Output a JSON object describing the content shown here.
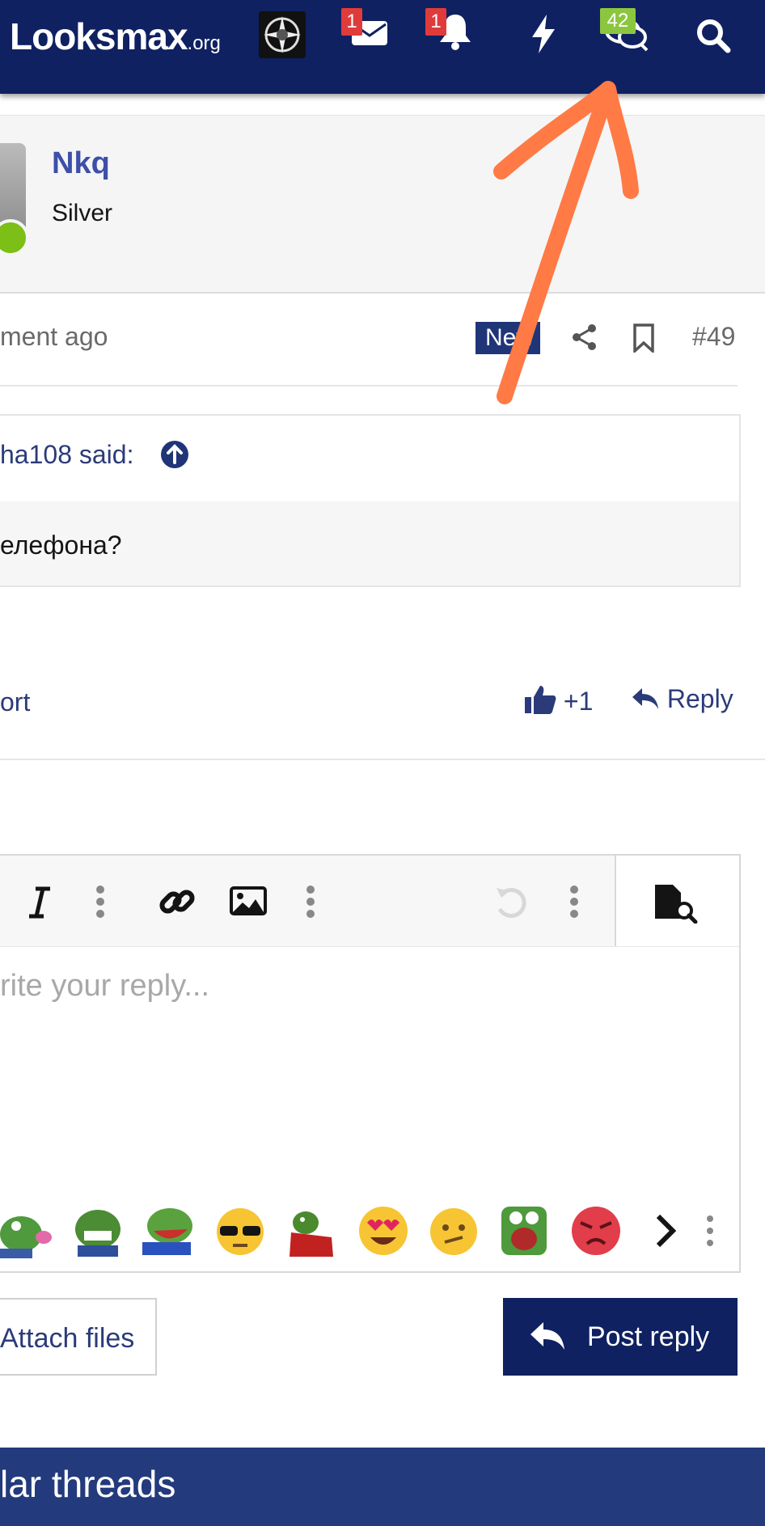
{
  "header": {
    "logo_main": "Looksmax",
    "logo_suffix": ".org",
    "messages_badge": "1",
    "alerts_badge": "1",
    "chats_badge": "42",
    "colors": {
      "bg": "#0f2161",
      "badge_red": "#e03b3b",
      "badge_green": "#8cc63f"
    }
  },
  "user": {
    "name": "Nkq",
    "title": "Silver",
    "online": true
  },
  "post_meta": {
    "time": "ment ago",
    "new_label": "New",
    "post_number": "#49"
  },
  "quote": {
    "author": "ha108 said:",
    "text": "елефона?"
  },
  "actions": {
    "report": "ort",
    "like": "+1",
    "reply": "Reply"
  },
  "editor": {
    "placeholder": "rite your reply...",
    "toolbar_icons": [
      "italic-icon",
      "more-icon",
      "link-icon",
      "image-icon",
      "more-icon",
      "undo-icon",
      "more-icon",
      "preview-icon"
    ],
    "emojis": [
      "pepe-kiss",
      "pepe-laugh-cry",
      "pepe-laugh",
      "sunglasses-flushed",
      "pepe-blood",
      "heart-eyes",
      "confused",
      "pepe-scream",
      "angry"
    ]
  },
  "buttons": {
    "attach": "Attach files",
    "post_reply": "Post reply"
  },
  "similar": {
    "title": "lar threads"
  },
  "annotation": {
    "color": "#ff7a45"
  }
}
